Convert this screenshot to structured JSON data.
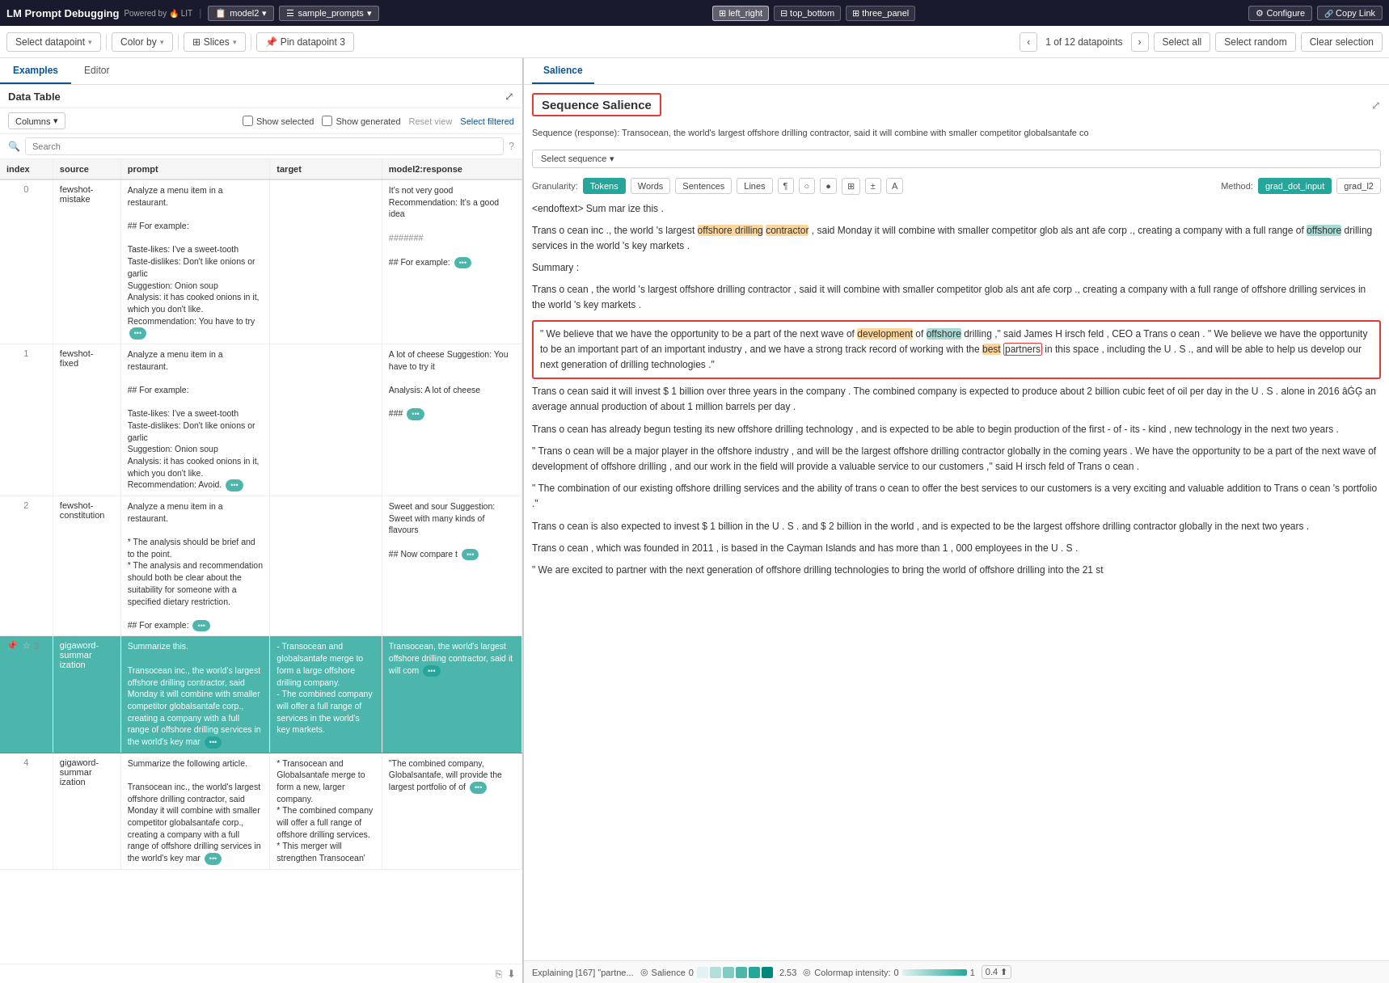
{
  "topbar": {
    "title": "LM Prompt Debugging",
    "powered_by": "Powered by 🔥 LIT",
    "model": "model2",
    "dataset": "sample_prompts",
    "layouts": [
      {
        "id": "left_right",
        "label": "left_right",
        "active": true
      },
      {
        "id": "top_bottom",
        "label": "top_bottom",
        "active": false
      },
      {
        "id": "three_panel",
        "label": "three_panel",
        "active": false
      }
    ],
    "configure_label": "Configure",
    "copy_link_label": "Copy Link"
  },
  "toolbar": {
    "select_datapoint_label": "Select datapoint",
    "color_by_label": "Color by",
    "slices_label": "Slices",
    "pin_label": "Pin datapoint 3",
    "nav_text": "1 of 12 datapoints",
    "select_all_label": "Select all",
    "select_random_label": "Select random",
    "clear_selection_label": "Clear selection"
  },
  "left_panel": {
    "tab_examples": "Examples",
    "tab_editor": "Editor",
    "data_table_title": "Data Table",
    "columns_label": "Columns",
    "show_selected_label": "Show selected",
    "show_generated_label": "Show generated",
    "reset_view_label": "Reset view",
    "select_filtered_label": "Select filtered",
    "search_placeholder": "Search",
    "table_headers": [
      "index",
      "source",
      "prompt",
      "target",
      "model2:response"
    ],
    "rows": [
      {
        "index": 0,
        "source": "fewshot-mistake",
        "prompt": "Analyze a menu item in a restaurant.\n\n## For example:\n\nTaste-likes: I've a sweet-tooth\nTaste-dislikes: Don't like onions or garlic\nSuggestion: Onion soup\nAnalysis: it has cooked onions in it, which you don't like.\nRecommendation: You have to try",
        "prompt_more": true,
        "target": "",
        "response": "It's not very good\nRecommendation: It's a good idea\n\n#######\n\n## For example:",
        "response_more": true,
        "selected": false,
        "pinned": false
      },
      {
        "index": 1,
        "source": "fewshot-fixed",
        "prompt": "Analyze a menu item in a restaurant.\n\n## For example:\n\nTaste-likes: I've a sweet-tooth\nTaste-dislikes: Don't like onions or garlic\nSuggestion: Onion soup\nAnalysis: it has cooked onions in it, which you don't like.\nRecommendation: Avoid.",
        "prompt_more": true,
        "target": "",
        "response": "A lot of cheese\nSuggestion: You have to try it\n\nAnalysis: A lot of cheese\n\n###",
        "response_more": true,
        "selected": false,
        "pinned": false
      },
      {
        "index": 2,
        "source": "fewshot-constitution",
        "prompt": "Analyze a menu item in a restaurant.\n\n* The analysis should be brief and to the point.\n* The analysis and recommendation should both be clear about the suitability for someone with a specified dietary restriction.\n\n## For example:",
        "prompt_more": true,
        "target": "",
        "response": "Sweet and sour\nSuggestion: Sweet with many kinds of flavours\n\n## Now compare t",
        "response_more": true,
        "selected": false,
        "pinned": false
      },
      {
        "index": 3,
        "source": "gigaword-summarization",
        "prompt": "Summarize this.\n\nTransocean inc., the world's largest offshore drilling contractor, said Monday it will combine with smaller competitor globalsantafe corp., creating a company with a full range of offshore drilling services in the world's key mar",
        "prompt_more": true,
        "target": "- Transocean and globalsantafe merge to form a large offshore drilling company.\n- The combined company will offer a full range of services in the world's key markets.",
        "response": "Transocean, the world's largest offshore drilling contractor, said it will com",
        "response_more": true,
        "selected": true,
        "pinned": true
      },
      {
        "index": 4,
        "source": "gigaword-summarization",
        "prompt": "Summarize the following article.\n\nTransocean inc., the world's largest offshore drilling contractor, said Monday it will combine with smaller competitor globalsantafe corp., creating a company with a full range of offshore drilling services in the world's key mar",
        "prompt_more": true,
        "target": "* Transocean and Globalsantafe merge to form a new, larger company.\n* The combined company will offer a full range of offshore drilling services.\n* This merger will strengthen Transocean'",
        "response": "\"The combined company, Globalsantafe, will provide the largest portfolio of of",
        "response_more": true,
        "selected": false,
        "pinned": false
      }
    ]
  },
  "right_panel": {
    "tab_salience": "Salience",
    "section_title": "Sequence Salience",
    "sequence_text": "Sequence (response): Transocean, the world's largest offshore drilling contractor, said it will combine with smaller competitor globalsantafe co",
    "select_sequence_label": "Select sequence",
    "granularity": {
      "label": "Granularity:",
      "options": [
        "Tokens",
        "Words",
        "Sentences",
        "Lines"
      ],
      "active": "Tokens"
    },
    "method": {
      "label": "Method:",
      "options": [
        "grad_dot_input",
        "grad_l2"
      ],
      "active": "grad_dot_input"
    },
    "response_paragraphs": [
      "<endoftext> Sum mar ize this .",
      "Trans o cean inc ., the world 's largest offshore drilling contractor , said Monday it will combine with smaller competitor glob als ant afe corp ., creating a company with a full range of offshore drilling services in the world 's key markets .",
      "Summary :",
      "Trans o cean , the world 's largest offshore drilling contractor , said it will combine with smaller competitor glob als ant afe corp ., creating a company with a full range of offshore drilling services in the world 's key markets .",
      "\" We believe that we have the opportunity to be a part of the next wave of development of offshore drilling ,\" said James H irsch feld , CEO a Trans o cean . \" We believe we have the opportunity to be an important part of an important industry , and we have a strong track record of working with the best partners in this space , including the U . S ., and will be able to help us develop our next generation of drilling technologies .\"",
      "Trans o cean said it will invest $ 1 billion over three years in the company . The combined company is expected to produce about 2 billion cubic feet of oil per day in the U . S . alone in 2016 âĠĢ an average annual production of about 1 million barrels per day .",
      "Trans o cean has already begun testing its new offshore drilling technology , and is expected to be able to begin production of the first - of - its - kind , new technology in the next two years .",
      "\" Trans o cean will be a major player in the offshore industry , and will be the largest offshore drilling contractor globally in the coming years . We have the opportunity to be a part of the next wave of development of offshore drilling , and our work in the field will provide a valuable service to our customers ,\" said H irsch feld of Trans o cean .",
      "\" The combination of our existing offshore drilling services and the ability of trans o cean to offer the best services to our customers is a very exciting and valuable addition to Trans o cean 's portfolio .\"",
      "Trans o cean is also expected to invest $ 1 billion in the U . S . and $ 2 billion in the world , and is expected to be the largest offshore drilling contractor globally in the next two years .",
      "Trans o cean , which was founded in 2011 , is based in the Cayman Islands and has more than 1 , 000 employees in the U . S .",
      "\" We are excited to partner with the next generation of offshore drilling technologies to bring the world of offshore drilling into the 21 st"
    ],
    "highlighted_paragraph_index": 4,
    "bottom_status": {
      "explaining_text": "Explaining [167] \"partne...",
      "salience_label": "Salience",
      "salience_value": "0",
      "colormap_label": "Colormap intensity:",
      "colormap_min": "0",
      "colormap_max": "1",
      "colormap_value": "0.4"
    }
  }
}
